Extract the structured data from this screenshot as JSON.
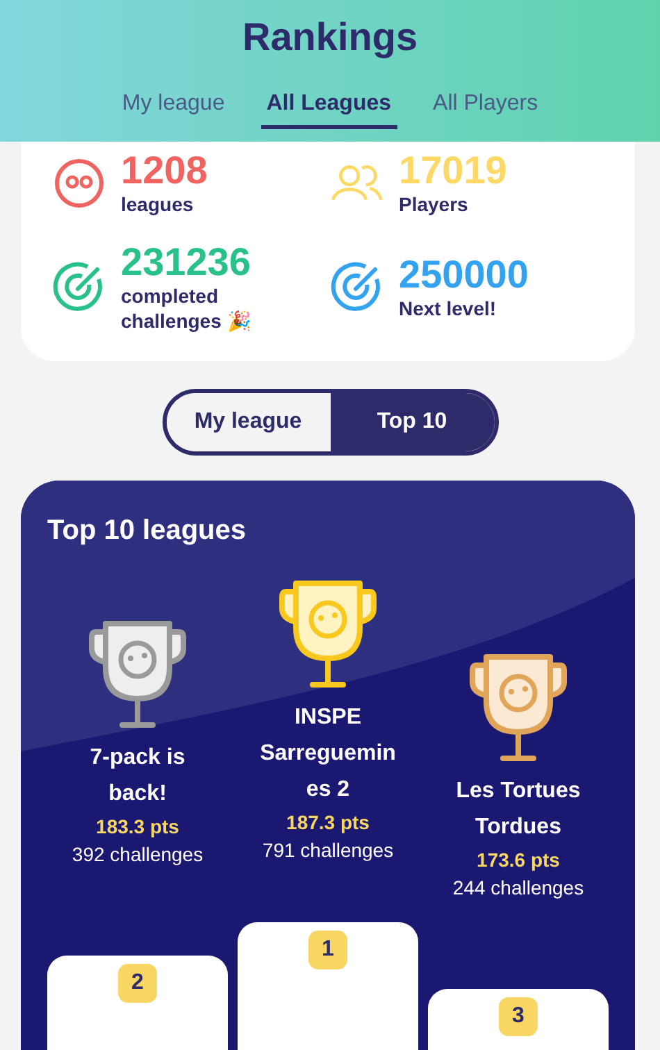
{
  "header": {
    "title": "Rankings"
  },
  "tabs": [
    {
      "label": "My league",
      "selected": false
    },
    {
      "label": "All Leagues",
      "selected": true
    },
    {
      "label": "All Players",
      "selected": false
    }
  ],
  "stats": [
    {
      "value": "1208",
      "label": "leagues",
      "kind": "face",
      "color": "#ef6461"
    },
    {
      "value": "17019",
      "label": "Players",
      "kind": "people",
      "color": "#fcd964"
    },
    {
      "value": "231236",
      "label": "completed challenges 🎉",
      "kind": "target",
      "color": "#28c08b"
    },
    {
      "value": "250000",
      "label": "Next level!",
      "kind": "target",
      "color": "#33a2ef"
    }
  ],
  "toggle": [
    {
      "label": "My league",
      "selected": false
    },
    {
      "label": "Top 10",
      "selected": true
    }
  ],
  "top10": {
    "title": "Top 10 leagues",
    "podium": [
      {
        "kind": "silver",
        "name": "7-pack is back!",
        "points": "183.3 pts",
        "challenges": "392 challenges",
        "rank": "2"
      },
      {
        "kind": "gold",
        "name": "INSPE Sarreguemines 2",
        "points": "187.3 pts",
        "challenges": "791 challenges",
        "rank": "1"
      },
      {
        "kind": "bronze",
        "name": "Les Tortues Tordues",
        "points": "173.6 pts",
        "challenges": "244 challenges",
        "rank": "3"
      }
    ]
  }
}
